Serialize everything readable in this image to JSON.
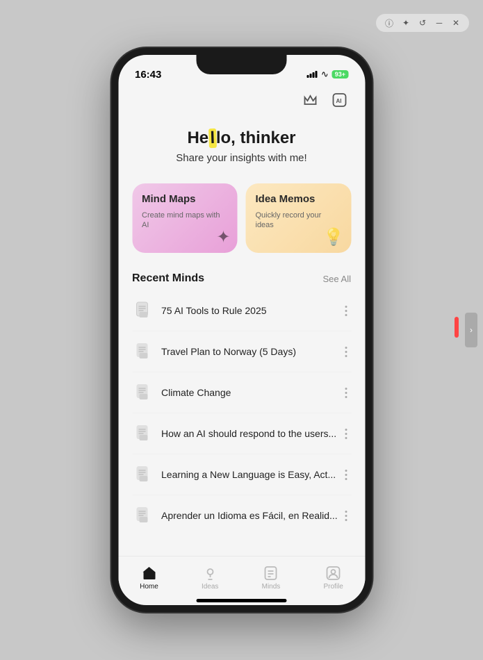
{
  "window": {
    "controls": [
      "info",
      "star",
      "refresh",
      "minimize",
      "close"
    ]
  },
  "statusBar": {
    "time": "16:43",
    "battery": "93+"
  },
  "topActions": {
    "crown_icon": "👑",
    "ai_icon": "AI"
  },
  "greeting": {
    "hello_prefix": "He",
    "hello_highlight": "l",
    "hello_suffix": "lo, thinker",
    "subtitle": "Share your insights with me!"
  },
  "cards": [
    {
      "id": "mind-maps",
      "title": "Mind Maps",
      "subtitle": "Create mind maps with AI",
      "deco": "✦"
    },
    {
      "id": "idea-memos",
      "title": "Idea Memos",
      "subtitle": "Quickly record your ideas",
      "deco": "💡"
    }
  ],
  "recentMinds": {
    "sectionTitle": "Recent Minds",
    "seeAll": "See All",
    "items": [
      {
        "id": 1,
        "text": "75 AI Tools to Rule 2025"
      },
      {
        "id": 2,
        "text": "Travel Plan to Norway (5 Days)"
      },
      {
        "id": 3,
        "text": "Climate Change"
      },
      {
        "id": 4,
        "text": "How an AI should respond to the users..."
      },
      {
        "id": 5,
        "text": "Learning a New Language is Easy, Act..."
      },
      {
        "id": 6,
        "text": "Aprender un Idioma es Fácil, en Realid..."
      }
    ]
  },
  "bottomNav": [
    {
      "id": "home",
      "label": "Home",
      "active": true
    },
    {
      "id": "ideas",
      "label": "Ideas",
      "active": false
    },
    {
      "id": "minds",
      "label": "Minds",
      "active": false
    },
    {
      "id": "profile",
      "label": "Profile",
      "active": false
    }
  ]
}
